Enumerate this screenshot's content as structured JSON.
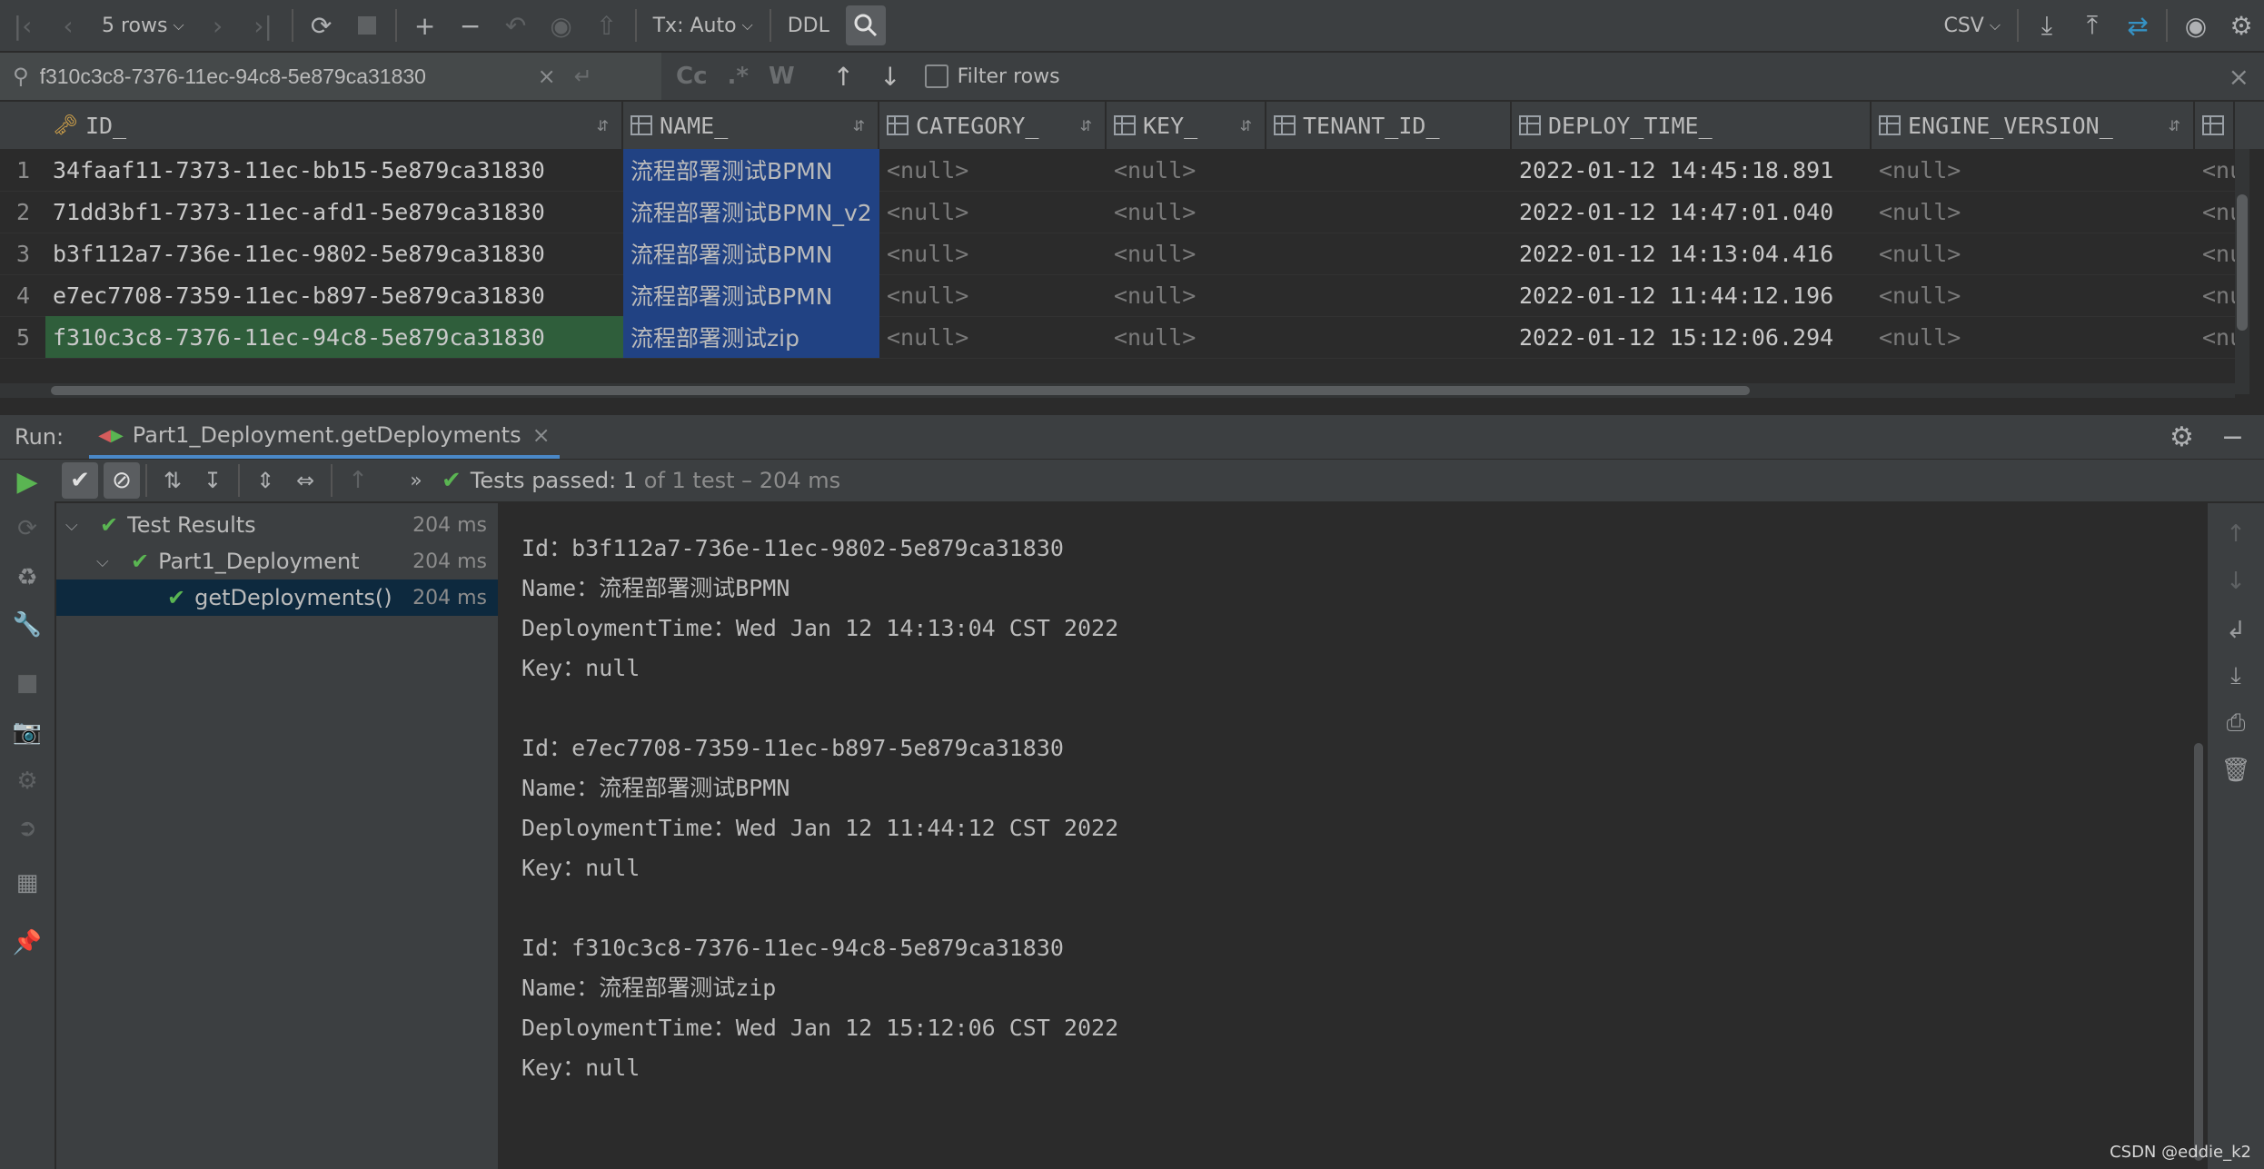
{
  "toolbar": {
    "rows_label": "5 rows",
    "tx_label": "Tx: Auto",
    "ddl_label": "DDL",
    "csv_label": "CSV"
  },
  "search": {
    "query": "f310c3c8-7376-11ec-94c8-5e879ca31830",
    "case_label": "Cc",
    "regex_label": ".*",
    "word_label": "W",
    "filter_rows_label": "Filter rows"
  },
  "grid": {
    "columns": [
      "ID_",
      "NAME_",
      "CATEGORY_",
      "KEY_",
      "TENANT_ID_",
      "DEPLOY_TIME_",
      "ENGINE_VERSION_"
    ],
    "rows": [
      {
        "num": "1",
        "id": "34faaf11-7373-11ec-bb15-5e879ca31830",
        "name": "流程部署测试BPMN",
        "category": "<null>",
        "key": "<null>",
        "tenant": "",
        "time": "2022-01-12 14:45:18.891",
        "engine": "<null>",
        "extra": "<nu"
      },
      {
        "num": "2",
        "id": "71dd3bf1-7373-11ec-afd1-5e879ca31830",
        "name": "流程部署测试BPMN_v2",
        "category": "<null>",
        "key": "<null>",
        "tenant": "",
        "time": "2022-01-12 14:47:01.040",
        "engine": "<null>",
        "extra": "<nu"
      },
      {
        "num": "3",
        "id": "b3f112a7-736e-11ec-9802-5e879ca31830",
        "name": "流程部署测试BPMN",
        "category": "<null>",
        "key": "<null>",
        "tenant": "",
        "time": "2022-01-12 14:13:04.416",
        "engine": "<null>",
        "extra": "<nu"
      },
      {
        "num": "4",
        "id": "e7ec7708-7359-11ec-b897-5e879ca31830",
        "name": "流程部署测试BPMN",
        "category": "<null>",
        "key": "<null>",
        "tenant": "",
        "time": "2022-01-12 11:44:12.196",
        "engine": "<null>",
        "extra": "<nu"
      },
      {
        "num": "5",
        "id": "f310c3c8-7376-11ec-94c8-5e879ca31830",
        "name": "流程部署测试zip",
        "category": "<null>",
        "key": "<null>",
        "tenant": "",
        "time": "2022-01-12 15:12:06.294",
        "engine": "<null>",
        "extra": "<nu"
      }
    ]
  },
  "run": {
    "label": "Run:",
    "tab_title": "Part1_Deployment.getDeployments",
    "status_prefix": "Tests passed: ",
    "status_count": "1",
    "status_suffix": " of 1 test – 204 ms"
  },
  "tree": [
    {
      "label": "Test Results",
      "time": "204 ms"
    },
    {
      "label": "Part1_Deployment",
      "time": "204 ms"
    },
    {
      "label": "getDeployments()",
      "time": "204 ms"
    }
  ],
  "console": [
    "Id：b3f112a7-736e-11ec-9802-5e879ca31830",
    "Name：流程部署测试BPMN",
    "DeploymentTime：Wed Jan 12 14:13:04 CST 2022",
    "Key：null",
    "Id：e7ec7708-7359-11ec-b897-5e879ca31830",
    "Name：流程部署测试BPMN",
    "DeploymentTime：Wed Jan 12 11:44:12 CST 2022",
    "Key：null",
    "Id：f310c3c8-7376-11ec-94c8-5e879ca31830",
    "Name：流程部署测试zip",
    "DeploymentTime：Wed Jan 12 15:12:06 CST 2022",
    "Key：null"
  ],
  "watermark": "CSDN @eddie_k2",
  "colors": {
    "accent_green": "#5ab552",
    "selection_blue": "#214283",
    "match_green": "#2f5e3b"
  }
}
